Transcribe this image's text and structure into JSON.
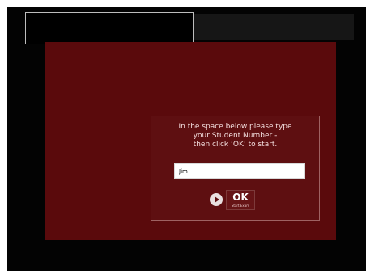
{
  "dialog": {
    "instruction_lines": [
      "In the space below please type",
      "your Student Number -",
      "then click ‘OK’ to start."
    ],
    "student_number_value": "Jim",
    "ok_label": "OK",
    "ok_sublabel": "Start Exam",
    "play_icon": "play-icon"
  },
  "colors": {
    "panel_background": "#5a0a0c",
    "dialog_border": "#9e6262",
    "outer_frame": "#030303"
  }
}
